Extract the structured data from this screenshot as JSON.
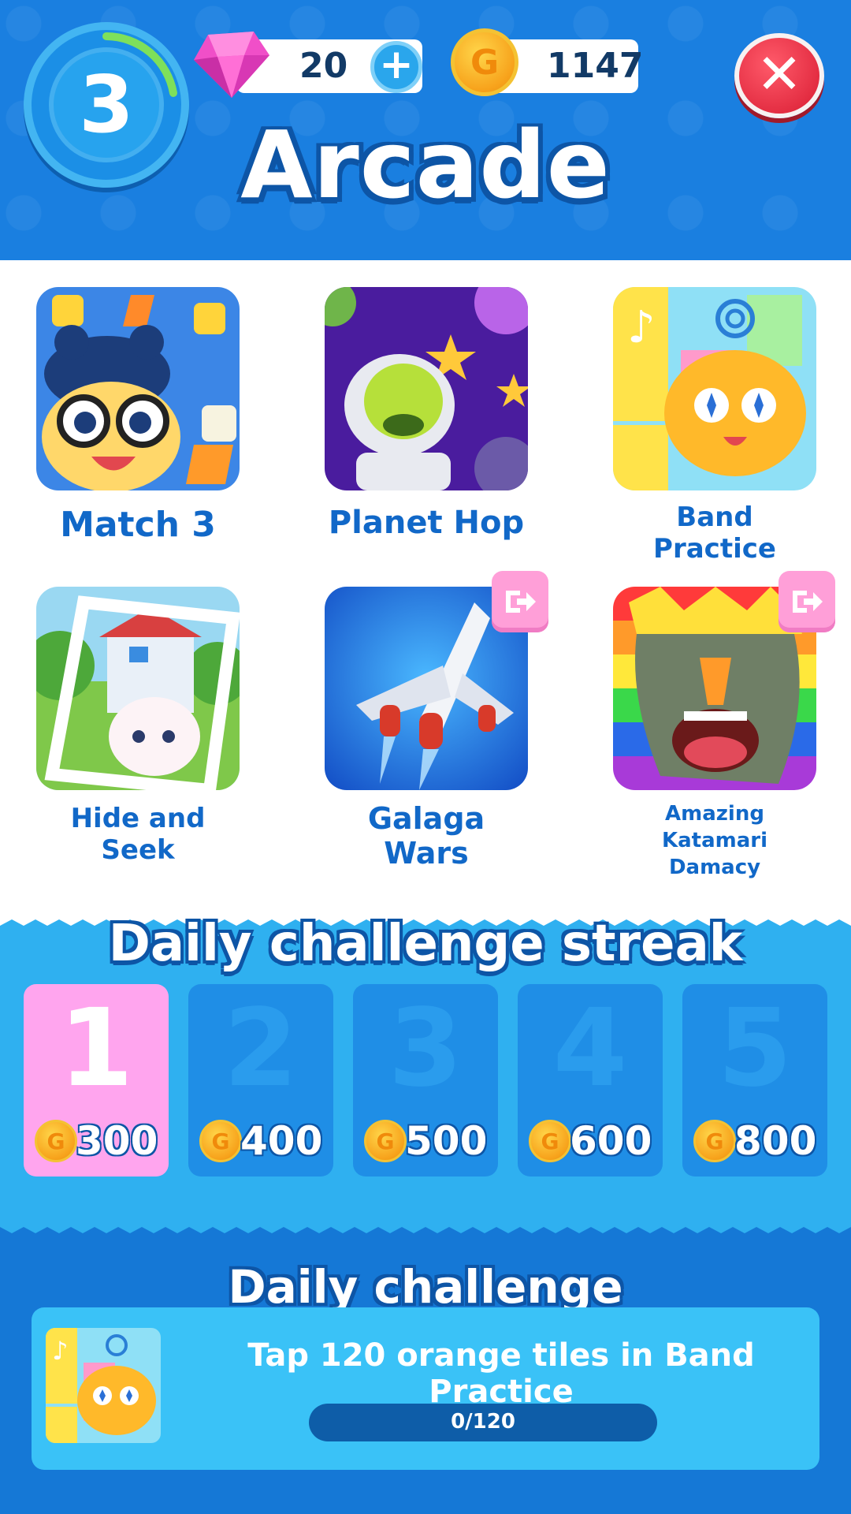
{
  "header": {
    "level": "3",
    "gems": "20",
    "coins": "1147",
    "title": "Arcade"
  },
  "games": [
    {
      "label": "Match 3",
      "external": false
    },
    {
      "label": "Planet Hop",
      "external": false
    },
    {
      "label": "Band Practice",
      "external": false
    },
    {
      "label": "Hide and Seek",
      "external": false
    },
    {
      "label": "Galaga Wars",
      "external": true
    },
    {
      "label": "Amazing Katamari Damacy",
      "external": true
    }
  ],
  "streak": {
    "title": "Daily challenge streak",
    "days": [
      {
        "day": "1",
        "reward": "300",
        "active": true
      },
      {
        "day": "2",
        "reward": "400",
        "active": false
      },
      {
        "day": "3",
        "reward": "500",
        "active": false
      },
      {
        "day": "4",
        "reward": "600",
        "active": false
      },
      {
        "day": "5",
        "reward": "800",
        "active": false
      }
    ]
  },
  "challenge": {
    "title": "Daily challenge",
    "text": "Tap 120 orange tiles in Band Practice",
    "progress_text": "0/120",
    "progress": 0
  },
  "icons": {
    "gem": "gem-icon",
    "coin": "coin-icon",
    "plus": "plus-icon",
    "close": "close-icon",
    "external": "external-link-icon"
  },
  "colors": {
    "header_bg": "#1a7fe0",
    "label_blue": "#1168c8",
    "active_day": "#ffa5ee",
    "close_red": "#e22b40",
    "gem_pink": "#f04fc8"
  }
}
